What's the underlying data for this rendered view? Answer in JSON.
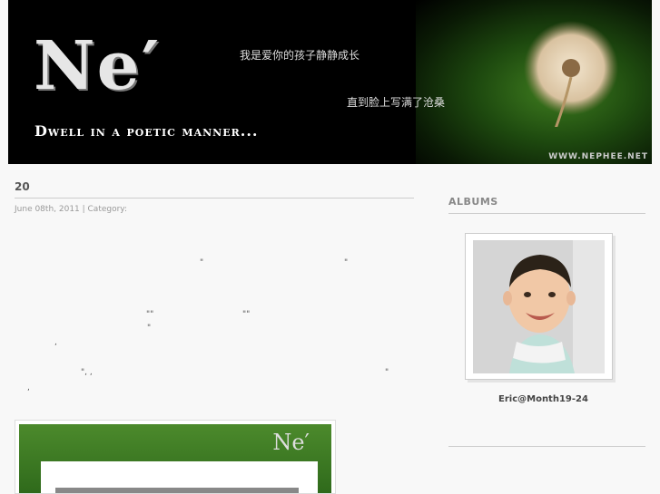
{
  "header": {
    "logo_text": "Ne′",
    "tagline": "Dwell in a poetic manner...",
    "poem_line1": "我是爱你的孩子静静成长",
    "poem_line2": "直到脸上写满了沧桑",
    "site_url": "WWW.NEPHEE.NET"
  },
  "post": {
    "title": "20",
    "meta": "June 08th, 2011 | Category:",
    "marks": [
      "\"",
      "\"",
      "\"\"",
      "\"\"",
      "\"",
      ",",
      "\", ,",
      "\"",
      ","
    ],
    "thumb_logo": "Ne′"
  },
  "sidebar": {
    "albums_title": "ALBUMS",
    "album_caption": "Eric@Month19-24"
  }
}
